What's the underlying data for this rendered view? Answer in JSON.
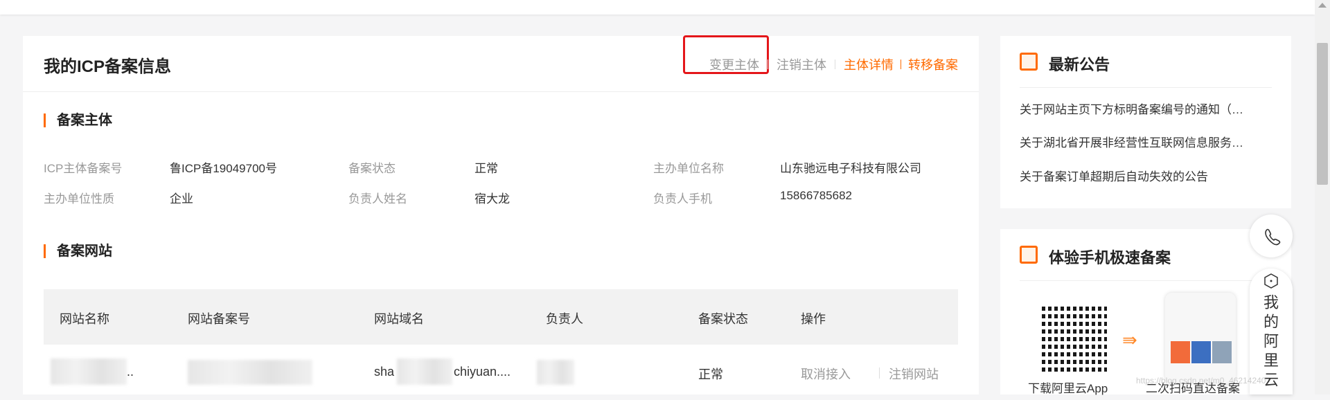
{
  "header": {
    "title": "我的ICP备案信息",
    "actions": {
      "change": "变更主体",
      "cancel": "注销主体",
      "detail": "主体详情",
      "transfer": "转移备案"
    }
  },
  "entity": {
    "section_title": "备案主体",
    "fields": [
      {
        "label": "ICP主体备案号",
        "value": "鲁ICP备19049700号"
      },
      {
        "label": "备案状态",
        "value": "正常"
      },
      {
        "label": "主办单位名称",
        "value": "山东驰远电子科技有限公司"
      },
      {
        "label": "主办单位性质",
        "value": "企业"
      },
      {
        "label": "负责人姓名",
        "value": "宿大龙"
      },
      {
        "label": "负责人手机",
        "value": "15866785682"
      }
    ]
  },
  "websites": {
    "section_title": "备案网站",
    "columns": [
      "网站名称",
      "网站备案号",
      "网站域名",
      "负责人",
      "备案状态",
      "操作"
    ],
    "row": {
      "name_suffix": "..",
      "domain_prefix": "sha",
      "domain_suffix": "chiyuan....",
      "status": "正常",
      "op_unbind": "取消接入",
      "op_cancel": "注销网站"
    }
  },
  "announcements": {
    "title": "最新公告",
    "items": [
      "关于网站主页下方标明备案编号的通知（…",
      "关于湖北省开展非经营性互联网信息服务…",
      "关于备案订单超期后自动失效的公告"
    ]
  },
  "mobile": {
    "title": "体验手机极速备案",
    "caption_app": "下载阿里云App",
    "caption_scan": "二次扫码直达备案"
  },
  "float": {
    "my_aliyun": "我的阿里云"
  },
  "watermark": "https://blog.csdn.net/m0_46214240",
  "colors": {
    "accent": "#ff6a00",
    "highlight": "#e4161a"
  }
}
